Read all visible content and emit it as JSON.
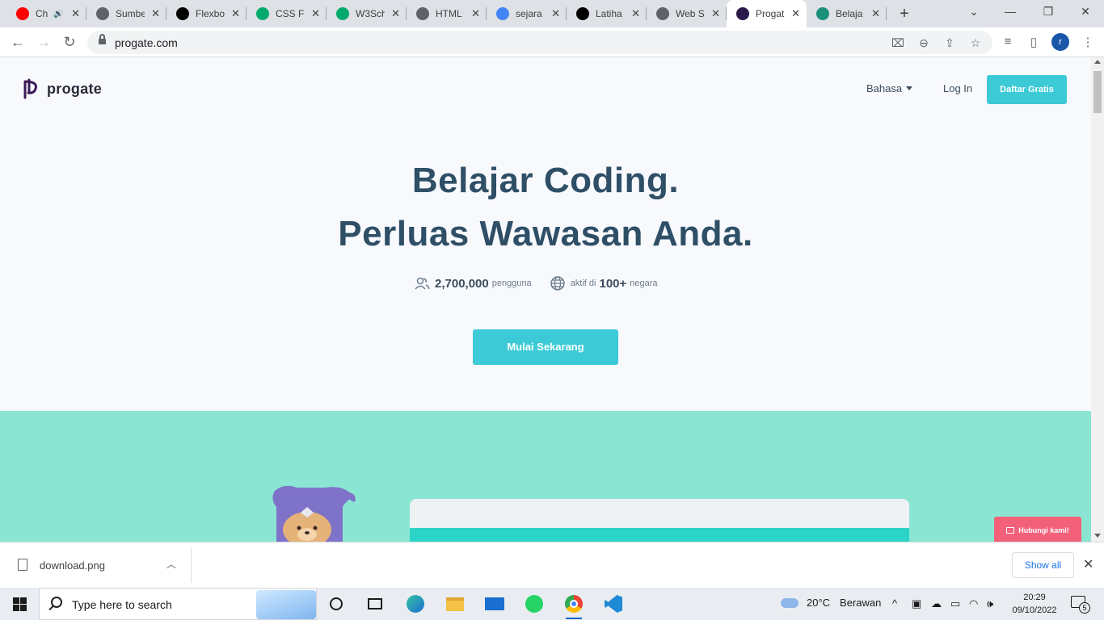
{
  "browser": {
    "tabs": [
      {
        "title": "Ch",
        "favicon": "youtube-icon",
        "color": "#ff0000",
        "audio": true
      },
      {
        "title": "Sumbe",
        "favicon": "globe-icon",
        "color": "#5f6368"
      },
      {
        "title": "Flexbo",
        "favicon": "notion-icon",
        "color": "#000000"
      },
      {
        "title": "CSS Fl",
        "favicon": "w3schools-icon",
        "color": "#04aa6d"
      },
      {
        "title": "W3Sch",
        "favicon": "w3schools-icon",
        "color": "#04aa6d"
      },
      {
        "title": "HTML",
        "favicon": "code-icon",
        "color": "#5f6368"
      },
      {
        "title": "sejara",
        "favicon": "google-icon",
        "color": "#4285f4"
      },
      {
        "title": "Latiha",
        "favicon": "notion-icon",
        "color": "#000000"
      },
      {
        "title": "Web S",
        "favicon": "globe-icon",
        "color": "#5f6368"
      },
      {
        "title": "Progat",
        "favicon": "progate-icon",
        "color": "#2a1a4a",
        "active": true
      },
      {
        "title": "Belaja",
        "favicon": "site-icon",
        "color": "#1a8f7a"
      }
    ],
    "url": "progate.com",
    "profile_initial": "r"
  },
  "site": {
    "logo_text": "progate",
    "nav": {
      "language": "Bahasa",
      "login": "Log In",
      "signup": "Daftar Gratis"
    },
    "hero": {
      "line1": "Belajar Coding.",
      "line2": "Perluas Wawasan Anda.",
      "users_count": "2,700,000",
      "users_label": "pengguna",
      "active_prefix": "aktif di",
      "countries_count": "100+",
      "countries_label": "negara",
      "cta": "Mulai Sekarang"
    },
    "contact_button": "Hubungi kami!"
  },
  "downloads": {
    "file_name": "download.png",
    "show_all": "Show all"
  },
  "taskbar": {
    "search_placeholder": "Type here to search",
    "weather_temp": "20°C",
    "weather_desc": "Berawan",
    "time": "20:29",
    "date": "09/10/2022",
    "notification_count": "5"
  },
  "colors": {
    "accent": "#3ccad6",
    "heading": "#2e4f66",
    "band": "#8ae6d2",
    "contact": "#f2607a"
  }
}
